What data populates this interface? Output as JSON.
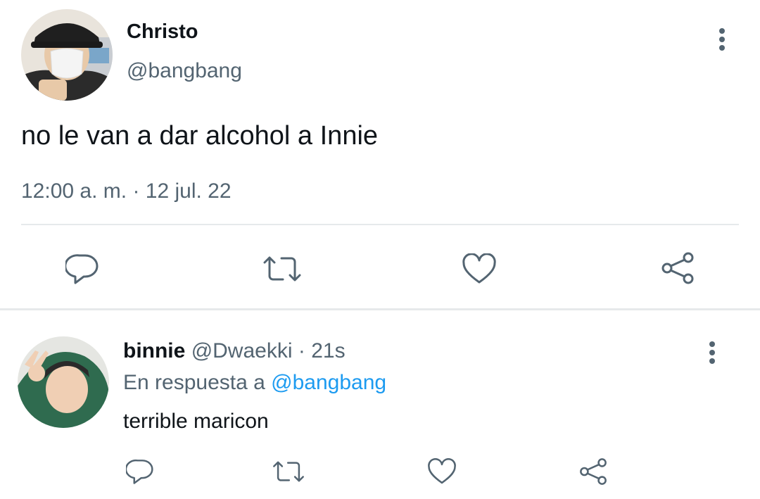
{
  "main_tweet": {
    "display_name": "Christo",
    "handle": "@bangbang",
    "text": "no le van a dar alcohol a Innie",
    "time": "12:00 a. m.",
    "separator": "·",
    "date": "12 jul. 22",
    "actions": [
      "reply-icon",
      "retweet-icon",
      "like-icon",
      "share-icon"
    ]
  },
  "reply_tweet": {
    "display_name": "binnie",
    "handle": "@Dwaekki",
    "separator": "·",
    "age": "21s",
    "reply_prefix": "En respuesta a",
    "reply_to": "@bangbang",
    "text": "terrible maricon",
    "actions": [
      "reply-icon",
      "retweet-icon",
      "like-icon",
      "share-icon"
    ]
  },
  "colors": {
    "text_primary": "#0f1419",
    "text_secondary": "#536471",
    "link": "#1d9bf0",
    "divider": "#e6e9eb"
  }
}
